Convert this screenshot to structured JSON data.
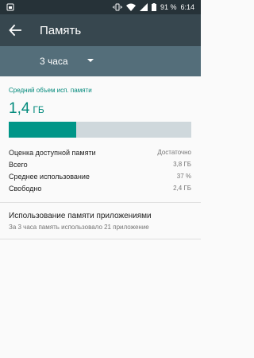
{
  "status_bar": {
    "battery": "91 %",
    "time": "6:14",
    "icons": [
      "sim-icon",
      "vibrate-icon",
      "wifi-icon",
      "signal-icon",
      "battery-icon"
    ]
  },
  "app_bar": {
    "title": "Память",
    "back_icon": "arrow-back-icon"
  },
  "period": {
    "selected": "3 часа"
  },
  "summary": {
    "label": "Средний объем исп. памяти",
    "value": "1,4",
    "unit": "ГБ",
    "usage_fraction": 0.37
  },
  "stats": [
    {
      "label": "Оценка доступной памяти",
      "value": "Достаточно"
    },
    {
      "label": "Всего",
      "value": "3,8 ГБ"
    },
    {
      "label": "Среднее использование",
      "value": "37 %"
    },
    {
      "label": "Свободно",
      "value": "2,4 ГБ"
    }
  ],
  "apps_usage": {
    "title": "Использование памяти приложениями",
    "subtitle": "За 3 часа память использовало 21 приложение"
  },
  "colors": {
    "status_bar": "#263238",
    "app_bar": "#37474f",
    "spinner_bar": "#546e7a",
    "accent": "#009688",
    "bar_track": "#cfd8dc"
  }
}
